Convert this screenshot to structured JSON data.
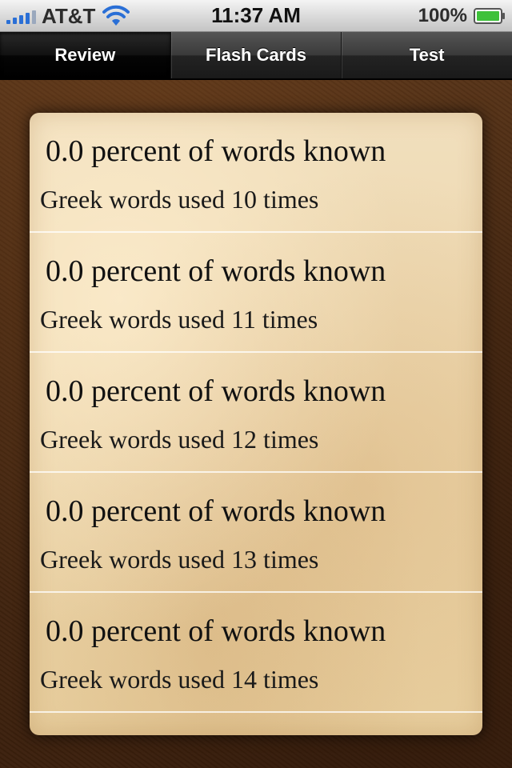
{
  "status_bar": {
    "carrier": "AT&T",
    "time": "11:37 AM",
    "battery_percent": "100%",
    "signal_icon": "signal-bars-icon",
    "wifi_icon": "wifi-icon",
    "battery_icon": "battery-icon"
  },
  "tabs": [
    {
      "label": "Review",
      "active": true
    },
    {
      "label": "Flash Cards",
      "active": false
    },
    {
      "label": "Test",
      "active": false
    }
  ],
  "list": {
    "items": [
      {
        "title": "0.0 percent of words known",
        "subtitle": "Greek words used 10 times"
      },
      {
        "title": "0.0 percent of words known",
        "subtitle": "Greek words used 11 times"
      },
      {
        "title": "0.0 percent of words known",
        "subtitle": "Greek words used 12 times"
      },
      {
        "title": "0.0 percent of words known",
        "subtitle": "Greek words used 13 times"
      },
      {
        "title": "0.0 percent of words known",
        "subtitle": "Greek words used 14 times"
      }
    ]
  },
  "colors": {
    "signal_blue": "#2a6fd6",
    "battery_green": "#3ec13a",
    "paper": "#ecd5aa",
    "leather": "#4a2a12"
  }
}
